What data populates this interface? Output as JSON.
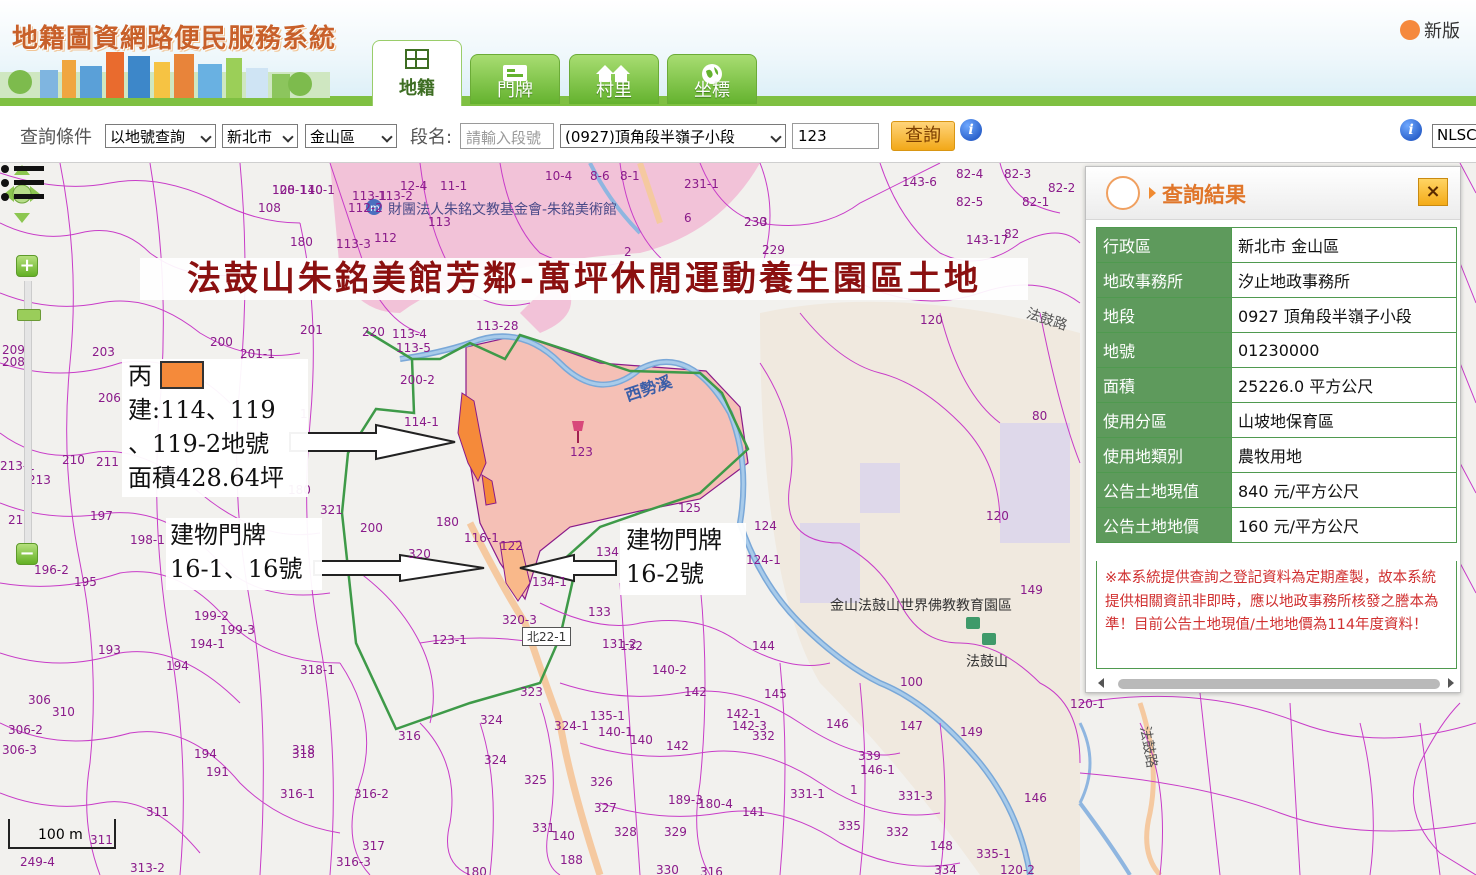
{
  "header": {
    "system_title": "地籍圖資網路便民服務系統",
    "new_version_label": "新版",
    "tabs": [
      {
        "label": "地籍",
        "icon": "cadastre-icon",
        "active": true
      },
      {
        "label": "門牌",
        "icon": "house-number-icon",
        "active": false
      },
      {
        "label": "村里",
        "icon": "village-icon",
        "active": false
      },
      {
        "label": "坐標",
        "icon": "globe-icon",
        "active": false
      }
    ]
  },
  "toolbar": {
    "criteria_label": "查詢條件",
    "query_type": "以地號查詢",
    "city": "新北市",
    "district": "金山區",
    "section_label": "段名:",
    "section_input_placeholder": "請輸入段號",
    "section_select": "(0927)頂角段半嶺子小段",
    "parcel_number": "123",
    "query_button": "查詢",
    "right_select": "NLSC"
  },
  "map": {
    "title": "法鼓山朱銘美館芳鄰-萬坪休閒運動養生園區土地",
    "note_parcel": {
      "marker": "丙",
      "swatch_color": "#f58a3a",
      "lines": [
        "建:114、119",
        "、119-2地號",
        "面積428.64坪"
      ]
    },
    "note_building_left": {
      "lines": [
        "建物門牌",
        "16-1、16號"
      ]
    },
    "note_building_right": {
      "lines": [
        "建物門牌",
        "16-2號"
      ]
    },
    "places": {
      "museum": "財團法人朱銘文教基金會-朱銘美術館",
      "temple": "金山法鼓山世界佛教教育園區",
      "dharma_drum": "法鼓山",
      "stream": "西勢溪",
      "road_1": "法鼓路",
      "road_2": "法鼓路",
      "road_badge": "北22-1"
    },
    "scale": "100 m",
    "parcel_labels": [
      "108-1",
      "110-1",
      "113-1",
      "113-2",
      "112-2",
      "12-4",
      "11-1",
      "10-4",
      "8-6",
      "8-1",
      "231-1",
      "143-6",
      "82-4",
      "82-3",
      "82-2",
      "82-5",
      "82-1",
      "108",
      "113",
      "112",
      "6",
      "230",
      "143-17",
      "82",
      "113-3",
      "180",
      "229",
      "2",
      "3",
      "220",
      "121",
      "201",
      "113-4",
      "113-5",
      "113-28",
      "120",
      "203",
      "201-1",
      "200",
      "200-2",
      "114-1",
      "1",
      "209",
      "206",
      "208",
      "213-1",
      "210",
      "211",
      "213",
      "212",
      "197",
      "198-1",
      "196-2",
      "195",
      "199-2",
      "199-3",
      "194-1",
      "193",
      "194",
      "306",
      "310",
      "306-2",
      "306-3",
      "194",
      "191",
      "318",
      "316-1",
      "316-2",
      "311",
      "313-2",
      "249-4",
      "311",
      "180",
      "321",
      "200",
      "180",
      "116-1",
      "320",
      "122",
      "123",
      "125",
      "124",
      "124-1",
      "134",
      "134-1",
      "133",
      "131-2",
      "132",
      "140-2",
      "142",
      "144",
      "123-1",
      "318-1",
      "320-3",
      "323",
      "324",
      "324-1",
      "135-1",
      "140-1",
      "140",
      "142",
      "142-1",
      "142-3",
      "332",
      "145",
      "146",
      "147",
      "149",
      "100",
      "318",
      "316",
      "324",
      "325",
      "326",
      "327",
      "328",
      "329",
      "330",
      "331",
      "140",
      "317",
      "316-3",
      "180",
      "188",
      "316",
      "189-3",
      "180-4",
      "141",
      "331-1",
      "331-3",
      "332",
      "148",
      "334",
      "335-1",
      "335",
      "339",
      "146-1",
      "146",
      "149",
      "80",
      "120",
      "120-1",
      "120-2",
      "1",
      "120",
      "140"
    ]
  },
  "result_panel": {
    "title": "查詢結果",
    "close_label": "×",
    "rows": [
      {
        "key": "行政區",
        "value": "新北市 金山區"
      },
      {
        "key": "地政事務所",
        "value": "汐止地政事務所"
      },
      {
        "key": "地段",
        "value": "0927 頂角段半嶺子小段"
      },
      {
        "key": "地號",
        "value": "01230000"
      },
      {
        "key": "面積",
        "value": "25226.0 平方公尺"
      },
      {
        "key": "使用分區",
        "value": "山坡地保育區"
      },
      {
        "key": "使用地類別",
        "value": "農牧用地"
      },
      {
        "key": "公告土地現值",
        "value": "840 元/平方公尺"
      },
      {
        "key": "公告土地地價",
        "value": "160 元/平方公尺"
      }
    ],
    "note": "※本系統提供查詢之登記資料為定期產製，故本系統提供相關資訊非即時，應以地政事務所核發之謄本為準！目前公告土地現值/土地地價為114年度資料！"
  }
}
